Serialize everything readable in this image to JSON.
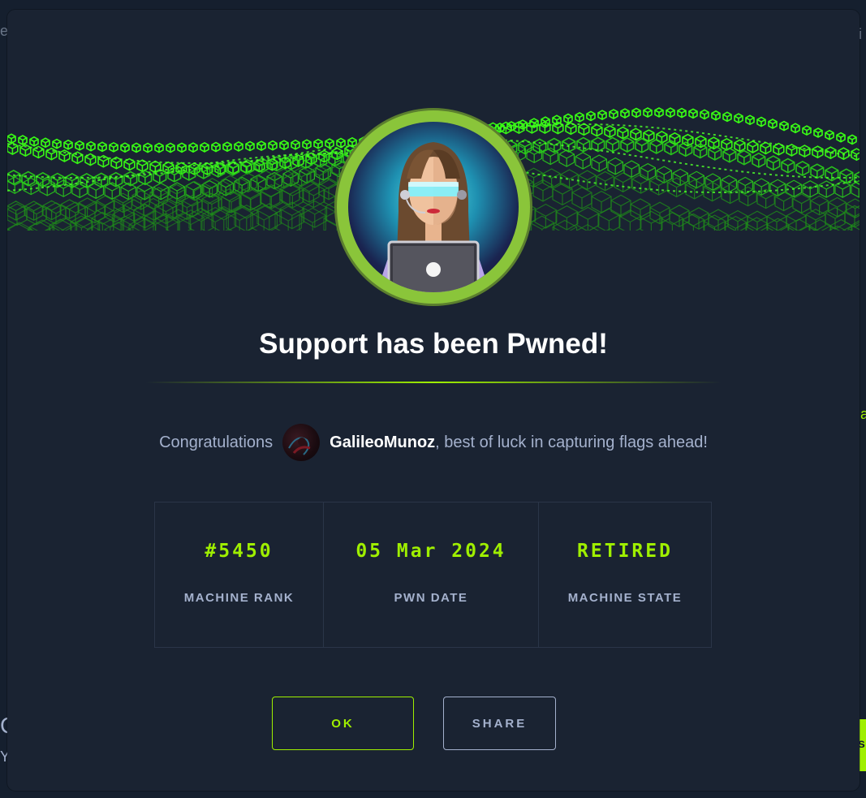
{
  "modal": {
    "title": "Support has been Pwned!",
    "congrats": {
      "prefix": "Congratulations",
      "username": "GalileoMunoz",
      "suffix": ", best of luck in capturing flags ahead!"
    },
    "stats": [
      {
        "value": "#5450",
        "label": "MACHINE RANK"
      },
      {
        "value": "05 Mar 2024",
        "label": "PWN DATE"
      },
      {
        "value": "RETIRED",
        "label": "MACHINE STATE"
      }
    ],
    "buttons": {
      "ok": "OK",
      "share": "SHARE"
    }
  },
  "background": {
    "edge_left_top": "e",
    "edge_right_top": "ri",
    "edge_left_bottom_1": "C",
    "edge_left_bottom_2": "Y",
    "edge_right_mid": "a",
    "edge_right_bottom": "s"
  },
  "colors": {
    "accent": "#9fef00",
    "modal_bg": "#1a2332",
    "text_muted": "#a4b1cd",
    "avatar_ring": "#8ac53a"
  },
  "icons": {
    "machine_avatar": "support-machine-avatar",
    "user_avatar": "user-avatar"
  }
}
